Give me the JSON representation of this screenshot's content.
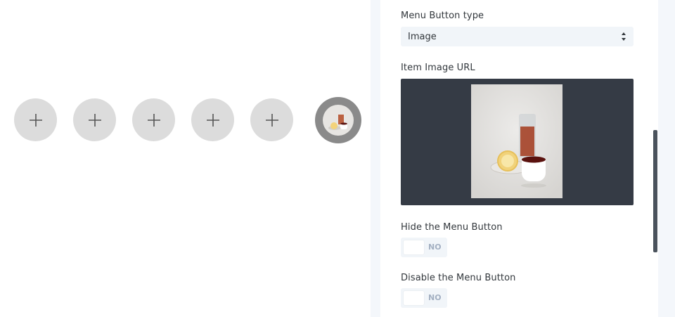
{
  "canvas": {
    "menu_buttons": [
      {
        "type": "add"
      },
      {
        "type": "add"
      },
      {
        "type": "add"
      },
      {
        "type": "add"
      },
      {
        "type": "add"
      },
      {
        "type": "image"
      }
    ]
  },
  "settings": {
    "menu_button_type": {
      "label": "Menu Button type",
      "value": "Image"
    },
    "item_image_url": {
      "label": "Item Image URL"
    },
    "hide_menu_button": {
      "label": "Hide the Menu Button",
      "state": "NO"
    },
    "disable_menu_button": {
      "label": "Disable the Menu Button",
      "state": "NO"
    }
  },
  "colors": {
    "panel_background": "#f4f7fb",
    "field_background": "#f1f5f9",
    "image_field_background": "#353b45",
    "add_button_fill": "#dcdcdc",
    "toggle_off_text": "#a3b0c2"
  },
  "icons": {
    "add": "plus-icon",
    "select": "select-arrows-icon"
  }
}
